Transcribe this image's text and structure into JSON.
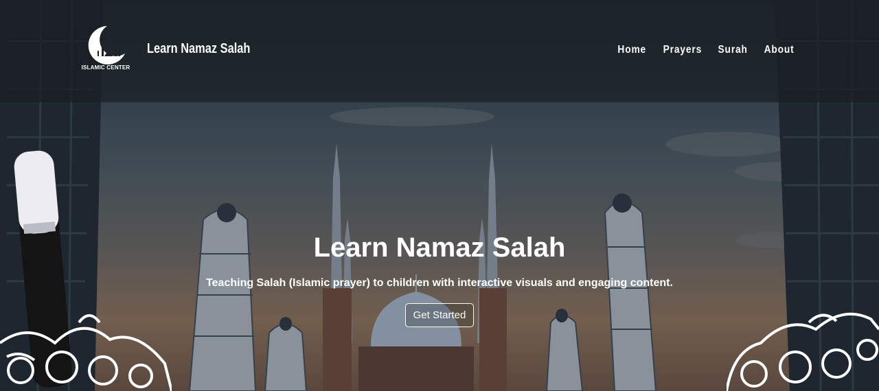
{
  "logo": {
    "text": "ISLAMIC CENTER",
    "icon": "crescent-mosque-icon"
  },
  "header": {
    "brand": "Learn Namaz Salah"
  },
  "nav": {
    "items": [
      {
        "label": "Home"
      },
      {
        "label": "Prayers"
      },
      {
        "label": "Surah"
      },
      {
        "label": "About"
      }
    ]
  },
  "hero": {
    "title": "Learn Namaz Salah",
    "subtitle": "Teaching Salah (Islamic prayer) to children with interactive visuals and engaging content.",
    "cta_label": "Get Started"
  },
  "colors": {
    "header_bg": "#1e2226",
    "text": "#ffffff"
  }
}
